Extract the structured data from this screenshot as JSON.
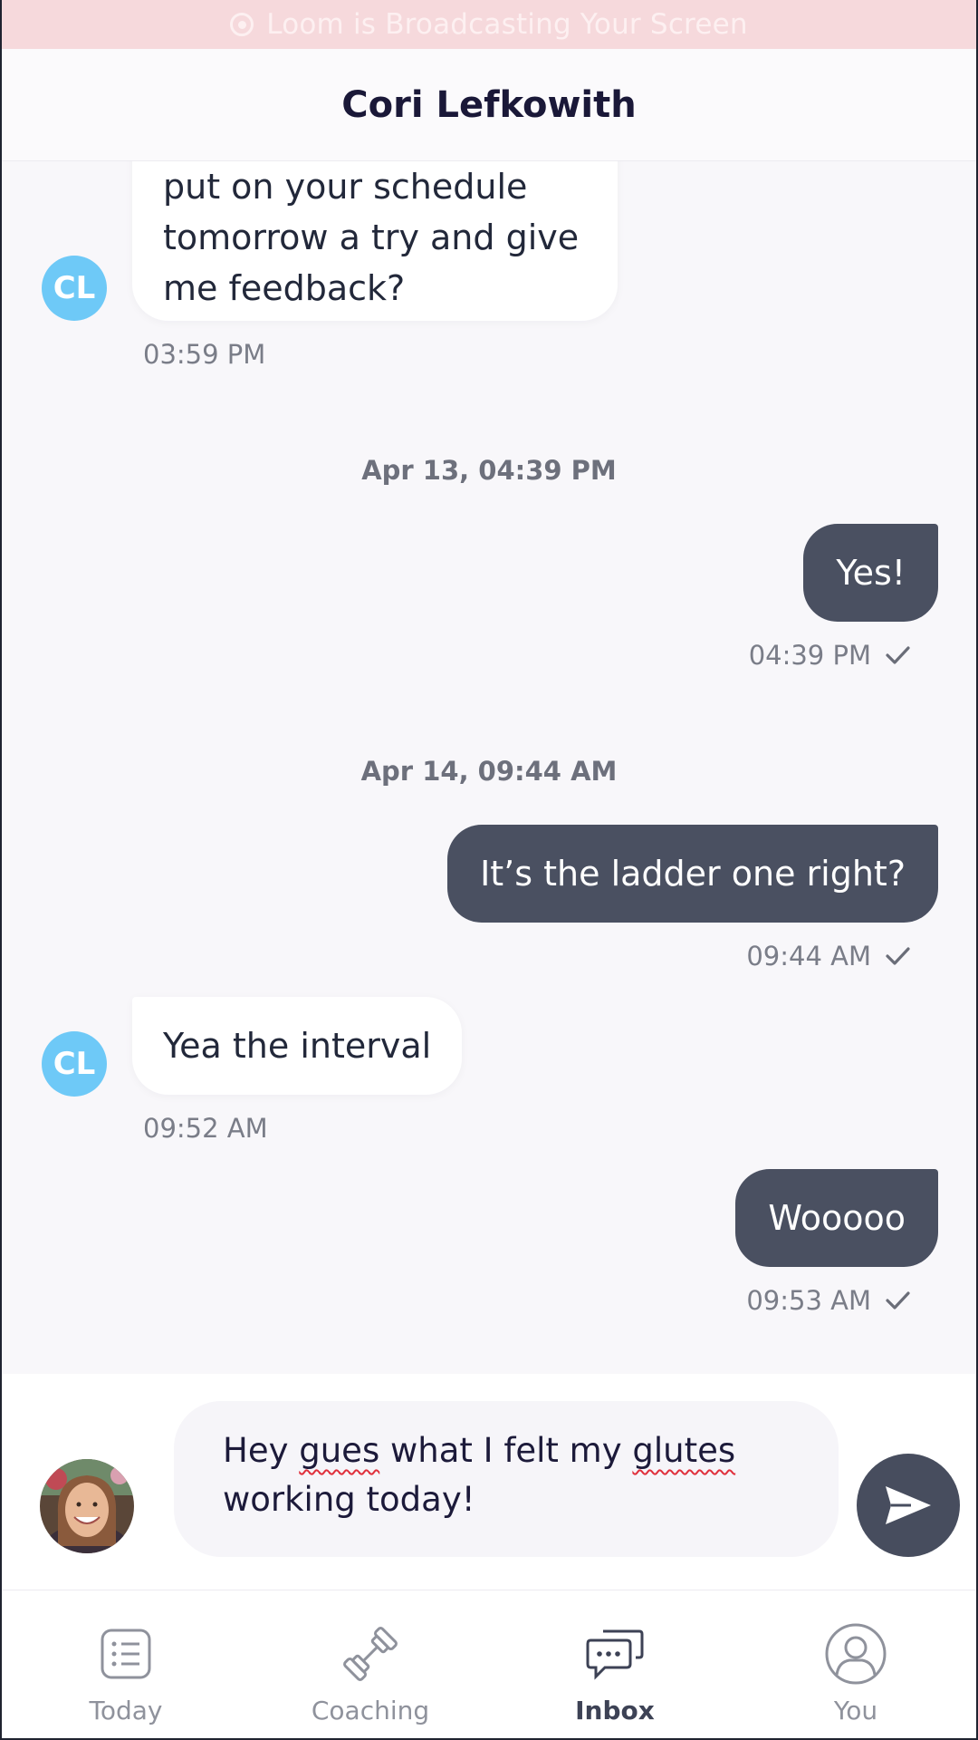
{
  "banner": {
    "text": "Loom is Broadcasting Your Screen",
    "icon": "record-icon"
  },
  "header": {
    "title": "Cori Lefkowith"
  },
  "chat": {
    "coach_initials": "CL",
    "messages": [
      {
        "direction": "incoming",
        "lines": [
          "put on your schedule",
          "tomorrow a try and give",
          "me feedback?"
        ],
        "time": "03:59 PM"
      },
      {
        "separator": "Apr 13, 04:39 PM"
      },
      {
        "direction": "outgoing",
        "text": "Yes!",
        "time": "04:39 PM",
        "status": "sent"
      },
      {
        "separator": "Apr 14, 09:44 AM"
      },
      {
        "direction": "outgoing",
        "text": "It’s the ladder one right?",
        "time": "09:44 AM",
        "status": "sent"
      },
      {
        "direction": "incoming",
        "text": "Yea the interval",
        "time": "09:52 AM"
      },
      {
        "direction": "outgoing",
        "text": "Wooooo",
        "time": "09:53 AM",
        "status": "sent"
      }
    ]
  },
  "composer": {
    "text_before_1": "Hey ",
    "misspell_1": "gues",
    "text_mid": " what I felt my ",
    "misspell_2": "glutes",
    "text_after": "working today!",
    "send_icon": "send-icon"
  },
  "tabs": [
    {
      "label": "Today",
      "icon": "list-icon",
      "active": false
    },
    {
      "label": "Coaching",
      "icon": "dumbbell-icon",
      "active": false
    },
    {
      "label": "Inbox",
      "icon": "chat-icon",
      "active": true
    },
    {
      "label": "You",
      "icon": "user-icon",
      "active": false
    }
  ],
  "colors": {
    "accent_dark": "#4a5061",
    "avatar_blue": "#6ec9f7",
    "banner_pink": "#f6d9dc"
  }
}
